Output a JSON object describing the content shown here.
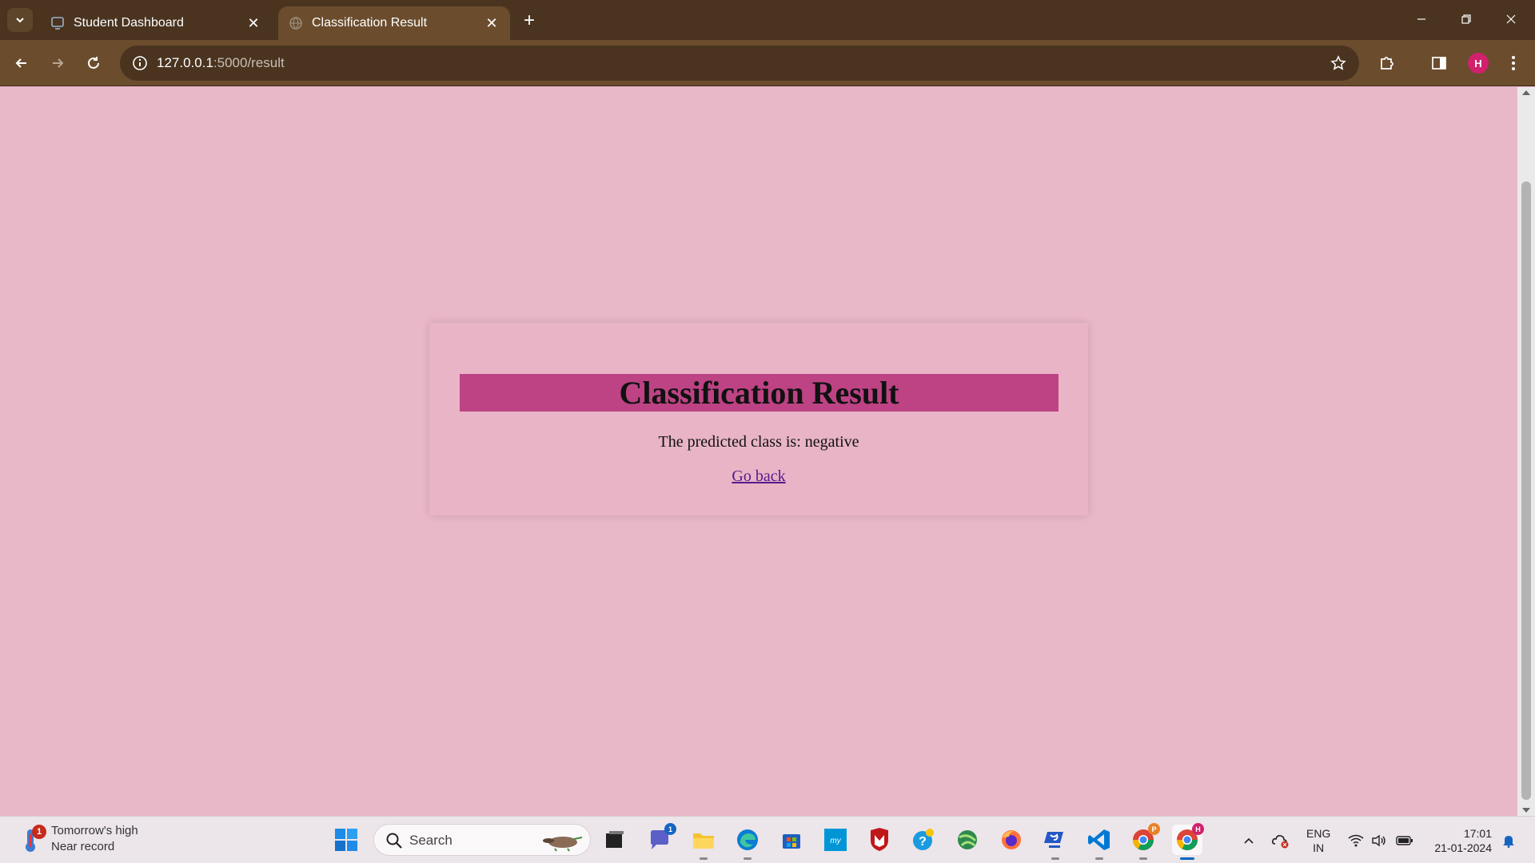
{
  "browser": {
    "tabs": [
      {
        "title": "Student Dashboard",
        "active": false
      },
      {
        "title": "Classification Result",
        "active": true
      }
    ],
    "url_host": "127.0.0.1",
    "url_path": ":5000/result",
    "profile_initial": "H",
    "accent_color": "#6b4d2e"
  },
  "page": {
    "heading": "Classification Result",
    "result_text": "The predicted class is: negative",
    "back_link": "Go back",
    "background_color": "#e8b7c8",
    "heading_bg_color": "#bd4384"
  },
  "taskbar": {
    "weather_badge": "1",
    "weather_line1": "Tomorrow's high",
    "weather_line2": "Near record",
    "search_placeholder": "Search",
    "teams_badge": "1",
    "chrome_p_badge": "P",
    "chrome_h_badge": "H",
    "lang_line1": "ENG",
    "lang_line2": "IN",
    "time": "17:01",
    "date": "21-01-2024"
  }
}
